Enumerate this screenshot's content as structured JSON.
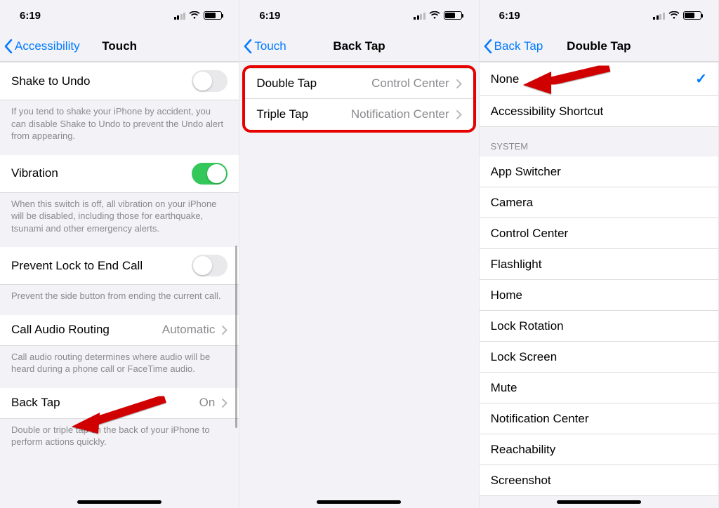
{
  "status": {
    "time": "6:19"
  },
  "p1": {
    "back": "Accessibility",
    "title": "Touch",
    "rows": {
      "shake": "Shake to Undo",
      "shake_footer": "If you tend to shake your iPhone by accident, you can disable Shake to Undo to prevent the Undo alert from appearing.",
      "vibration": "Vibration",
      "vibration_footer": "When this switch is off, all vibration on your iPhone will be disabled, including those for earthquake, tsunami and other emergency alerts.",
      "prevent": "Prevent Lock to End Call",
      "prevent_footer": "Prevent the side button from ending the current call.",
      "audio": "Call Audio Routing",
      "audio_val": "Automatic",
      "audio_footer": "Call audio routing determines where audio will be heard during a phone call or FaceTime audio.",
      "backtap": "Back Tap",
      "backtap_val": "On",
      "backtap_footer": "Double or triple tap on the back of your iPhone to perform actions quickly."
    }
  },
  "p2": {
    "back": "Touch",
    "title": "Back Tap",
    "double": "Double Tap",
    "double_val": "Control Center",
    "triple": "Triple Tap",
    "triple_val": "Notification Center"
  },
  "p3": {
    "back": "Back Tap",
    "title": "Double Tap",
    "none": "None",
    "access": "Accessibility Shortcut",
    "system_header": "System",
    "items": [
      "App Switcher",
      "Camera",
      "Control Center",
      "Flashlight",
      "Home",
      "Lock Rotation",
      "Lock Screen",
      "Mute",
      "Notification Center",
      "Reachability",
      "Screenshot"
    ]
  }
}
